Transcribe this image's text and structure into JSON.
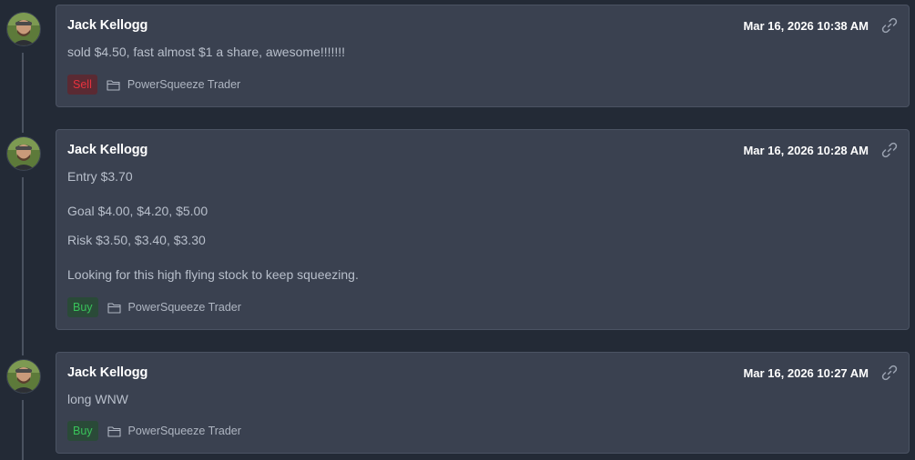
{
  "colors": {
    "background": "#232a36",
    "card": "#3a4150",
    "sell": "#e8323e",
    "buy": "#39c25a"
  },
  "posts": [
    {
      "author": "Jack Kellogg",
      "timestamp": "Mar 16, 2026 10:38 AM",
      "lines": [
        "sold $4.50, fast almost $1 a share, awesome!!!!!!!"
      ],
      "badge": "Sell",
      "channel": "PowerSqueeze Trader",
      "icons": {
        "avatar": "avatar-photo",
        "link": "link-icon",
        "folder": "folder-icon"
      }
    },
    {
      "author": "Jack Kellogg",
      "timestamp": "Mar 16, 2026 10:28 AM",
      "lines": [
        "Entry $3.70",
        "Goal $4.00, $4.20, $5.00",
        "Risk $3.50, $3.40, $3.30",
        "Looking for this high flying stock to keep squeezing."
      ],
      "badge": "Buy",
      "channel": "PowerSqueeze Trader",
      "icons": {
        "avatar": "avatar-photo",
        "link": "link-icon",
        "folder": "folder-icon"
      }
    },
    {
      "author": "Jack Kellogg",
      "timestamp": "Mar 16, 2026 10:27 AM",
      "lines": [
        "long WNW"
      ],
      "badge": "Buy",
      "channel": "PowerSqueeze Trader",
      "icons": {
        "avatar": "avatar-photo",
        "link": "link-icon",
        "folder": "folder-icon"
      }
    }
  ]
}
